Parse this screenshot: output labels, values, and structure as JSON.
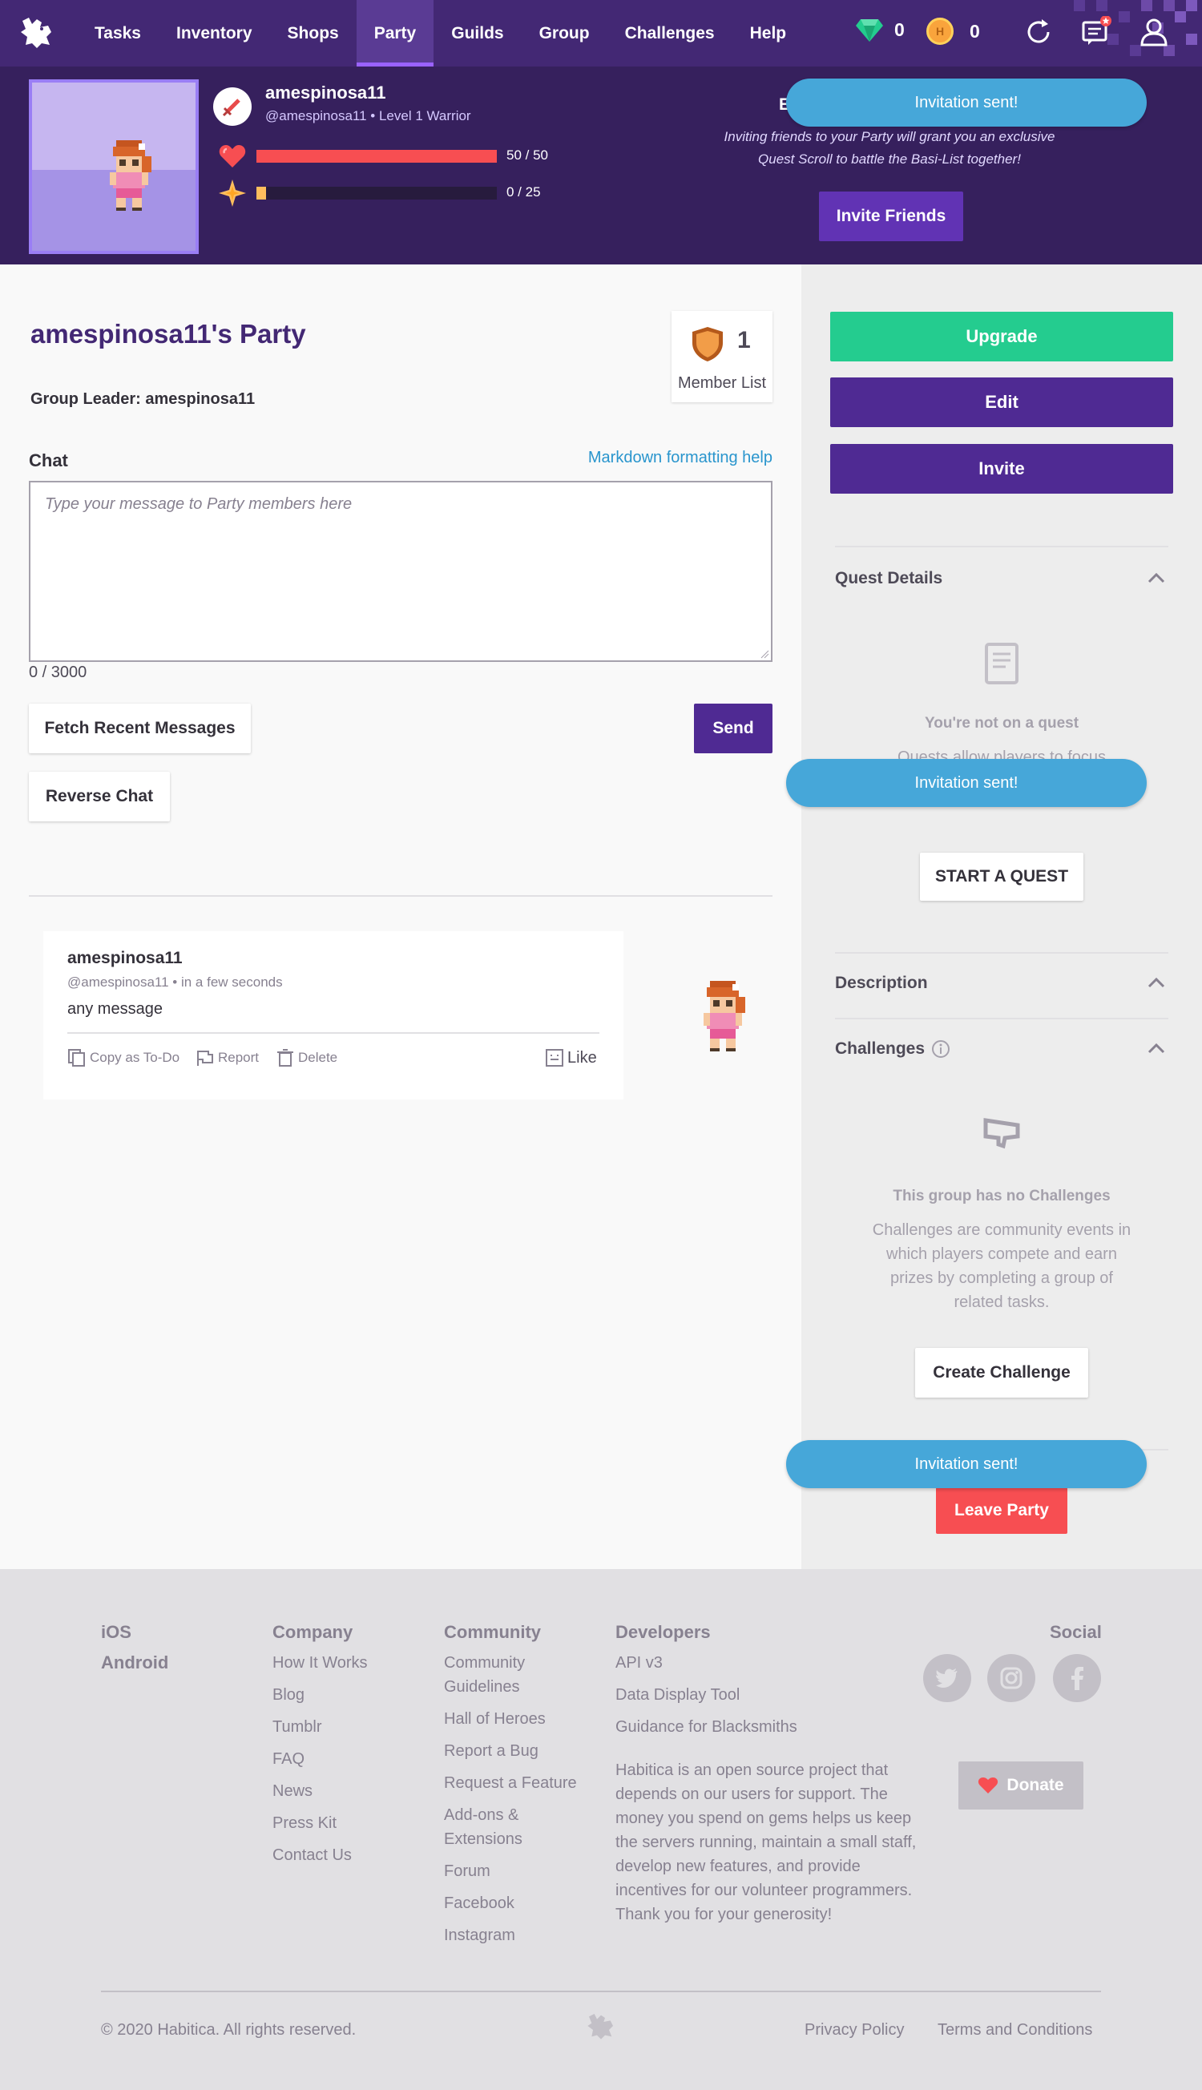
{
  "nav": {
    "items": [
      "Tasks",
      "Inventory",
      "Shops",
      "Party",
      "Guilds",
      "Group",
      "Challenges",
      "Help"
    ],
    "active": "Party",
    "gems": "0",
    "gold": "0"
  },
  "profile": {
    "username": "amespinosa11",
    "handle_line": "@amespinosa11 • Level 1 Warrior",
    "hp_label": "50 / 50",
    "hp_fraction": 1.0,
    "xp_label": "0 / 25",
    "xp_fraction": 0.04
  },
  "invite_panel": {
    "title": "E",
    "text": "Inviting friends to your Party will grant you an exclusive Quest Scroll to battle the Basi-List together!",
    "button": "Invite Friends"
  },
  "toasts": [
    "Invitation sent!",
    "Invitation sent!",
    "Invitation sent!"
  ],
  "party": {
    "title": "amespinosa11's Party",
    "leader_label": "Group Leader:",
    "leader_name": "amespinosa11",
    "member_count": "1",
    "member_label": "Member List"
  },
  "chat": {
    "label": "Chat",
    "markdown_help": "Markdown formatting help",
    "placeholder": "Type your message to Party members here",
    "char_count": "0 / 3000",
    "fetch_button": "Fetch Recent Messages",
    "send_button": "Send",
    "reverse_button": "Reverse Chat"
  },
  "message": {
    "user": "amespinosa11",
    "meta": "@amespinosa11 • in a few seconds",
    "text": "any message",
    "actions": {
      "copy": "Copy as To-Do",
      "report": "Report",
      "delete": "Delete",
      "like": "Like"
    }
  },
  "sidebar": {
    "upgrade": "Upgrade",
    "edit": "Edit",
    "invite": "Invite",
    "quest_title": "Quest Details",
    "quest_empty_title": "You're not on a quest",
    "quest_empty_body": "Quests allow players to focus on members of their party.",
    "start_quest": "START A QUEST",
    "description_title": "Description",
    "challenges_title": "Challenges",
    "challenges_empty_title": "This group has no Challenges",
    "challenges_empty_body": "Challenges are community events in which players compete and earn prizes by completing a group of related tasks.",
    "create_challenge": "Create Challenge",
    "leave_party": "Leave Party"
  },
  "footer": {
    "apps": [
      "iOS",
      "Android"
    ],
    "company": {
      "title": "Company",
      "links": [
        "How It Works",
        "Blog",
        "Tumblr",
        "FAQ",
        "News",
        "Press Kit",
        "Contact Us"
      ]
    },
    "community": {
      "title": "Community",
      "links": [
        "Community Guidelines",
        "Hall of Heroes",
        "Report a Bug",
        "Request a Feature",
        "Add-ons & Extensions",
        "Forum",
        "Facebook",
        "Instagram"
      ]
    },
    "developers": {
      "title": "Developers",
      "links": [
        "API v3",
        "Data Display Tool",
        "Guidance for Blacksmiths"
      ]
    },
    "about": "Habitica is an open source project that depends on our users for support. The money you spend on gems helps us keep the servers running, maintain a small staff, develop new features, and provide incentives for our volunteer programmers. Thank you for your generosity!",
    "social_title": "Social",
    "donate": "Donate",
    "copyright": "© 2020 Habitica. All rights reserved.",
    "privacy": "Privacy Policy",
    "terms": "Terms and Conditions"
  },
  "colors": {
    "nav_bg": "#432874",
    "header_bg": "#36205d",
    "purple_button": "#4f2a93",
    "upgrade_green": "#24cc8f",
    "hp_red": "#f74e52",
    "xp_yellow": "#ffbe5d",
    "toast_blue": "#46a7d9",
    "leave_red": "#f74e52"
  }
}
